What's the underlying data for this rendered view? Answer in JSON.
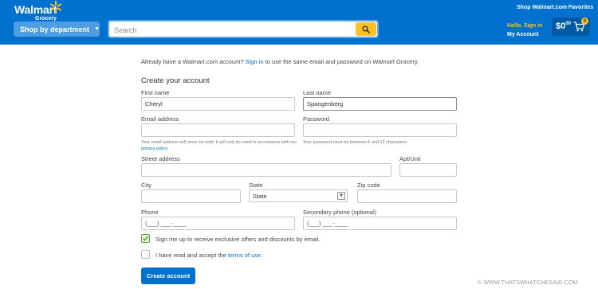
{
  "header": {
    "logo_word": "Walmart",
    "logo_sub": "Grocery",
    "dept_label": "Shop by department",
    "search_placeholder": "Search",
    "shop_walmart": "Shop Walmart.com",
    "favorites": "Favorites",
    "hello": "Hello, Sign in",
    "my_account": "My Account",
    "cart_dollars": "$0",
    "cart_cents": "00",
    "cart_count": "0",
    "brand_color": "#0071ce",
    "accent_color": "#ffc220"
  },
  "intro": {
    "prefix": "Already have a Walmart.com account?",
    "link": "Sign in",
    "suffix": "to use the same email and password on Walmart Grocery."
  },
  "form": {
    "title": "Create your account",
    "first_name_label": "First name",
    "first_name_value": "Cheryl",
    "last_name_label": "Last name",
    "last_name_value": "Spangenberg",
    "email_label": "Email address",
    "email_value": "",
    "email_hint_prefix": "Your email address will never be sold. It will only be used in accordance with our",
    "email_hint_link": "privacy policy.",
    "password_label": "Password",
    "password_value": "",
    "password_hint": "Your password must be between 6 and 12 characters.",
    "street_label": "Street address",
    "apt_label": "Apt/Unit",
    "city_label": "City",
    "state_label": "State",
    "state_value": "State",
    "zip_label": "Zip code",
    "phone_label": "Phone",
    "phone_value": "(___) ___-____",
    "secondary_phone_label": "Secondary phone (optional)",
    "secondary_phone_value": "(___) ___-____",
    "offers_text": "Sign me up to receive exclusive offers and discounts by email.",
    "offers_checked": true,
    "terms_prefix": "I have read and accept the",
    "terms_link": "terms of use.",
    "terms_checked": false,
    "submit_label": "Create account"
  },
  "watermark": "© WWW.THATSWHATCHESAID.COM"
}
